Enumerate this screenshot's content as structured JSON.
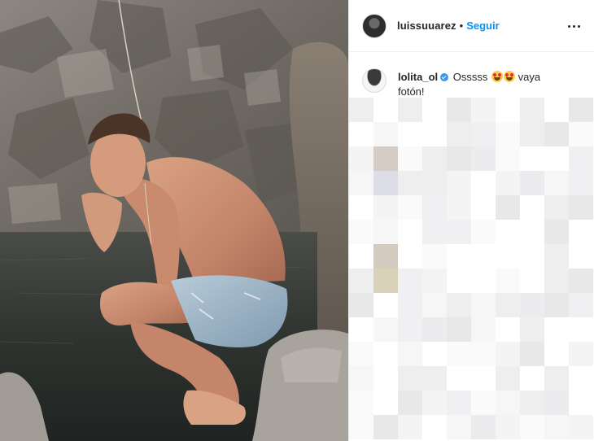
{
  "post": {
    "username": "luissuuarez",
    "separator": "•",
    "follow_label": "Seguir",
    "more_icon": "more-options-icon"
  },
  "comment": {
    "username": "lolita_ol",
    "text_start": "Osssss",
    "text_end": "vaya fotón!",
    "emoji": "heart-eyes-emoji",
    "verified": true
  },
  "colors": {
    "accent": "#0095f6",
    "verified": "#3897f0",
    "border": "#efefef"
  }
}
